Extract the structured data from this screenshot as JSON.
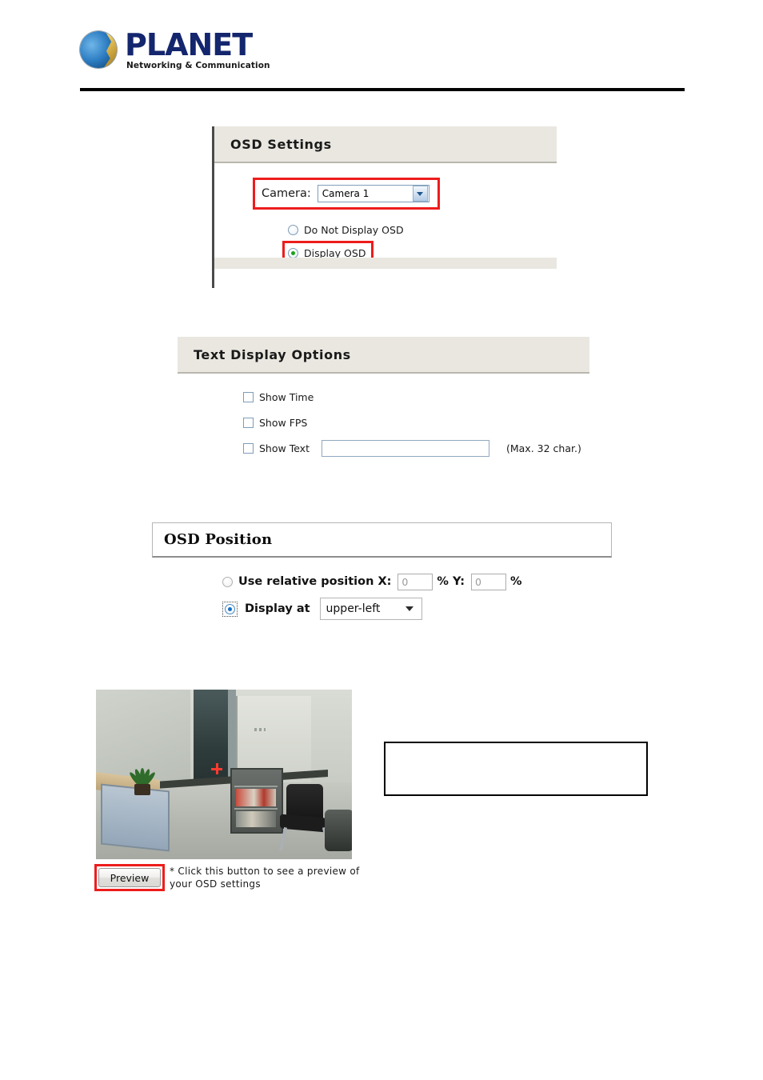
{
  "header": {
    "logo_word": "PLANET",
    "logo_tagline": "Networking & Communication",
    "logo_icon": "planet-globe-icon"
  },
  "osd_settings": {
    "title": "OSD Settings",
    "camera_label": "Camera:",
    "camera_value": "Camera 1",
    "camera_dropdown_icon": "chevron-down-icon",
    "radios": [
      {
        "label": "Do Not Display OSD",
        "checked": false
      },
      {
        "label": "Display OSD",
        "checked": true
      }
    ],
    "highlight_color": "#ee1c1c"
  },
  "text_display_options": {
    "title": "Text Display Options",
    "checkboxes": [
      {
        "label": "Show Time",
        "checked": false
      },
      {
        "label": "Show FPS",
        "checked": false
      },
      {
        "label": "Show Text",
        "checked": false
      }
    ],
    "text_value": "",
    "max_char_note": "(Max. 32 char.)"
  },
  "osd_position": {
    "title": "OSD Position",
    "relative_label": "Use relative position X:",
    "x_value": "0",
    "x_percent": "%",
    "y_label": "Y:",
    "y_value": "0",
    "y_percent": "%",
    "display_at_label": "Display at",
    "display_at_value": "upper-left",
    "display_at_icon": "chevron-down-icon",
    "relative_checked": false,
    "display_at_checked": true
  },
  "preview": {
    "image_alt": "camera-preview-office-room",
    "crosshair_icon": "crosshair-marker-icon",
    "button_label": "Preview",
    "note": "* Click this button to see a preview of\nyour OSD settings",
    "highlight_color": "#ee1c1c"
  },
  "callout": {
    "text": ""
  }
}
